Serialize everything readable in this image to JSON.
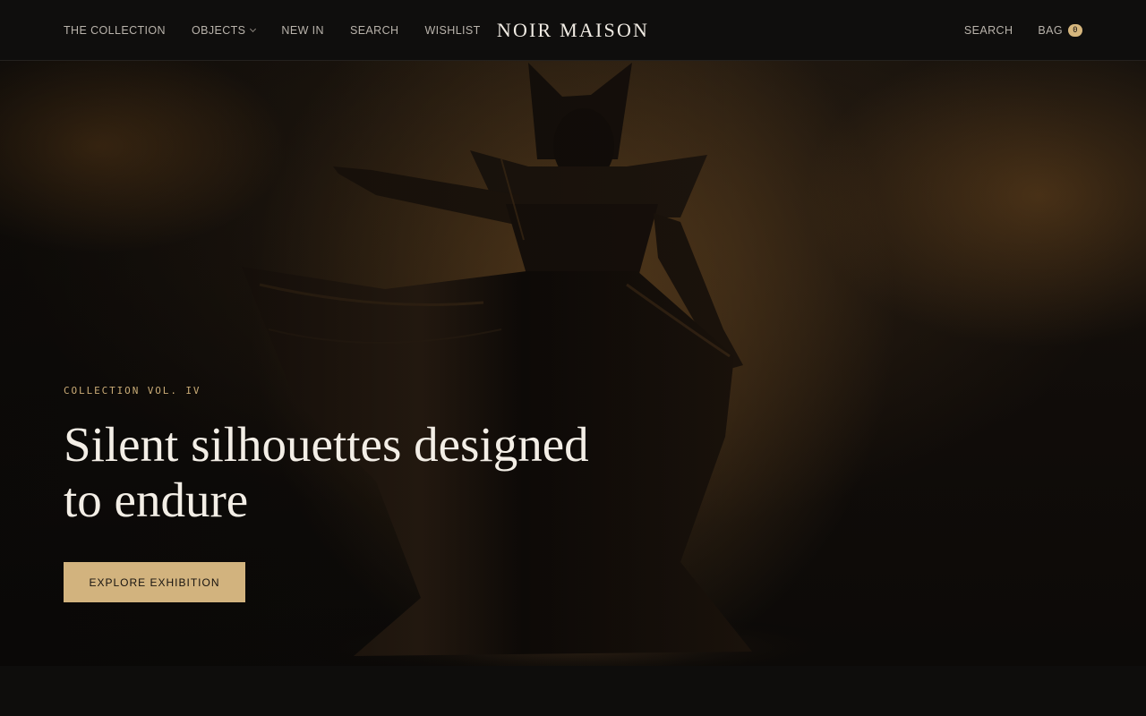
{
  "header": {
    "nav_left": [
      {
        "label": "THE COLLECTION"
      },
      {
        "label": "OBJECTS"
      },
      {
        "label": "NEW IN"
      },
      {
        "label": "SEARCH"
      },
      {
        "label": "WISHLIST"
      }
    ],
    "logo": "NOIR MAISON",
    "nav_right": {
      "search_label": "SEARCH",
      "bag_label": "BAG",
      "bag_count": "0"
    }
  },
  "hero": {
    "eyebrow": "COLLECTION VOL. IV",
    "headline_line1": "Silent silhouettes designed",
    "headline_line2": "to endure",
    "cta_label": "EXPLORE EXHIBITION"
  },
  "colors": {
    "background": "#0e0d0c",
    "accent": "#d2b37e",
    "headline": "#f3eee6"
  }
}
